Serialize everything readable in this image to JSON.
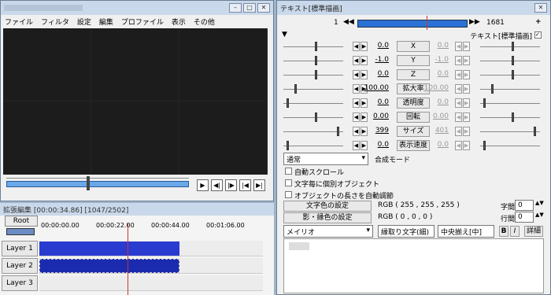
{
  "left_window": {
    "menu": [
      "ファイル",
      "フィルタ",
      "設定",
      "編集",
      "プロファイル",
      "表示",
      "その他"
    ]
  },
  "timeline": {
    "title": "拡張編集 [00:00:34.86] [1047/2502]",
    "root_label": "Root",
    "ruler": [
      "00:00:00.00",
      "00:00:22.00",
      "00:00:44.00",
      "00:01:06.00"
    ],
    "layers": [
      "Layer 1",
      "Layer 2",
      "Layer 3"
    ],
    "clip_color": "#1a2bb0"
  },
  "right_panel": {
    "title": "テキスト[標準描画]",
    "frame_start": "1",
    "frame_end": "1681",
    "effect_label": "テキスト[標準描画]",
    "params": [
      {
        "name": "X",
        "left": "0.0",
        "right": "0.0",
        "slider_l": 0.55,
        "slider_r": 0.55
      },
      {
        "name": "Y",
        "left": "-1.0",
        "right": "-1.0",
        "slider_l": 0.55,
        "slider_r": 0.55
      },
      {
        "name": "Z",
        "left": "0.0",
        "right": "0.0",
        "slider_l": 0.55,
        "slider_r": 0.55
      },
      {
        "name": "拡大率",
        "left": "100.00",
        "right": "100.00",
        "slider_l": 0.2,
        "slider_r": 0.2
      },
      {
        "name": "透明度",
        "left": "0.0",
        "right": "0.0",
        "slider_l": 0.05,
        "slider_r": 0.05
      },
      {
        "name": "回転",
        "left": "0.00",
        "right": "0.00",
        "slider_l": 0.55,
        "slider_r": 0.55
      },
      {
        "name": "サイズ",
        "left": "399",
        "right": "401",
        "slider_l": 0.95,
        "slider_r": 0.95
      },
      {
        "name": "表示速度",
        "left": "0.0",
        "right": "0.0",
        "slider_l": 0.05,
        "slider_r": 0.05
      }
    ],
    "blend_mode": "通常",
    "blend_label": "合成モード",
    "checks": [
      "自動スクロール",
      "文字毎に個別オブジェクト",
      "オブジェクトの長さを自動調節"
    ],
    "text_color_button": "文字色の設定",
    "text_color_value": "RGB ( 255 , 255 , 255 )",
    "shadow_color_button": "影・縁色の設定",
    "shadow_color_value": "RGB ( 0 , 0 , 0 )",
    "spacing_label": "字間",
    "spacing_value": "0",
    "line_label": "行間",
    "line_value": "0",
    "font": "メイリオ",
    "outline_mode": "縁取り文字(細)",
    "align": "中央揃え[中]",
    "bold": "B",
    "italic": "I",
    "detail": "詳細"
  }
}
